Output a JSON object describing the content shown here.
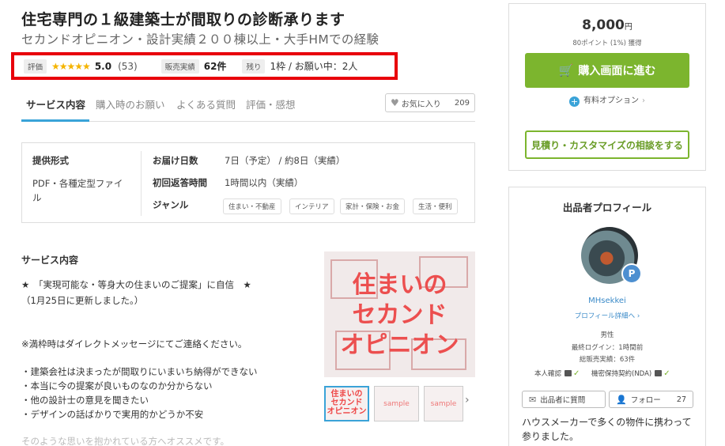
{
  "header": {
    "title": "住宅専門の１級建築士が間取りの診断承ります",
    "subtitle": "セカンドオピニオン・設計実績２００棟以上・大手HMでの経験"
  },
  "stats": {
    "rating_tag": "評価",
    "stars": "★★★★★",
    "rating": "5.0",
    "reviews": "(53)",
    "sales_tag": "販売実績",
    "sales": "62件",
    "remaining_tag": "残り",
    "remaining": "1枠 / お願い中：2人"
  },
  "tabs": [
    {
      "label": "サービス内容"
    },
    {
      "label": "購入時のお願い"
    },
    {
      "label": "よくある質問"
    },
    {
      "label": "評価・感想"
    }
  ],
  "favorite": {
    "label": "お気に入り",
    "count": "209"
  },
  "info": {
    "format_label": "提供形式",
    "format_value": "PDF・各種定型ファイル",
    "delivery_label": "お届け日数",
    "delivery_value": "7日（予定） / 約8日（実績）",
    "reply_label": "初回返答時間",
    "reply_value": "1時間以内（実績）",
    "genre_label": "ジャンル",
    "genres": [
      "住まい・不動産",
      "インテリア",
      "家計・保険・お金",
      "生活・便利"
    ]
  },
  "service": {
    "heading": "サービス内容",
    "lines": [
      "★　「実現可能な・等身大の住まいのご提案」に自信　★",
      "（1月25日に更新しました。）",
      "※満枠時はダイレクトメッセージにてご連絡ください。",
      "・建築会社は決まったが間取りにいまいち納得ができない",
      "・本当に今の提案が良いものなのか分からない",
      "・他の設計士の意見を聞きたい",
      "・デザインの話ばかりで実用的かどうか不安",
      "そのような思いを抱かれている方へオススメです。"
    ]
  },
  "image": {
    "main_text": "住まいの\nセカンド\nオピニオン",
    "thumb1_text": "住まいの\nセカンド\nオピニオン",
    "sample": "sample"
  },
  "purchase": {
    "price": "8,000",
    "yen": "円",
    "points": "80ポイント (1%) 獲得",
    "buy_label": "購入画面に進む",
    "option_label": "有料オプション",
    "estimate_label": "見積り・カスタマイズの相談をする"
  },
  "profile": {
    "heading": "出品者プロフィール",
    "badge": "P",
    "name": "MHsekkei",
    "detail_link": "プロフィール詳細へ ›",
    "gender": "男性",
    "last_login": "最終ログイン：1時間前",
    "total_sales": "総販売実績：63件",
    "identity": "本人確認",
    "nda": "機密保持契約(NDA)",
    "question_label": "出品者に質問",
    "follow_label": "フォロー",
    "follow_count": "27",
    "intro": "ハウスメーカーで多くの物件に携わって参りました。"
  }
}
